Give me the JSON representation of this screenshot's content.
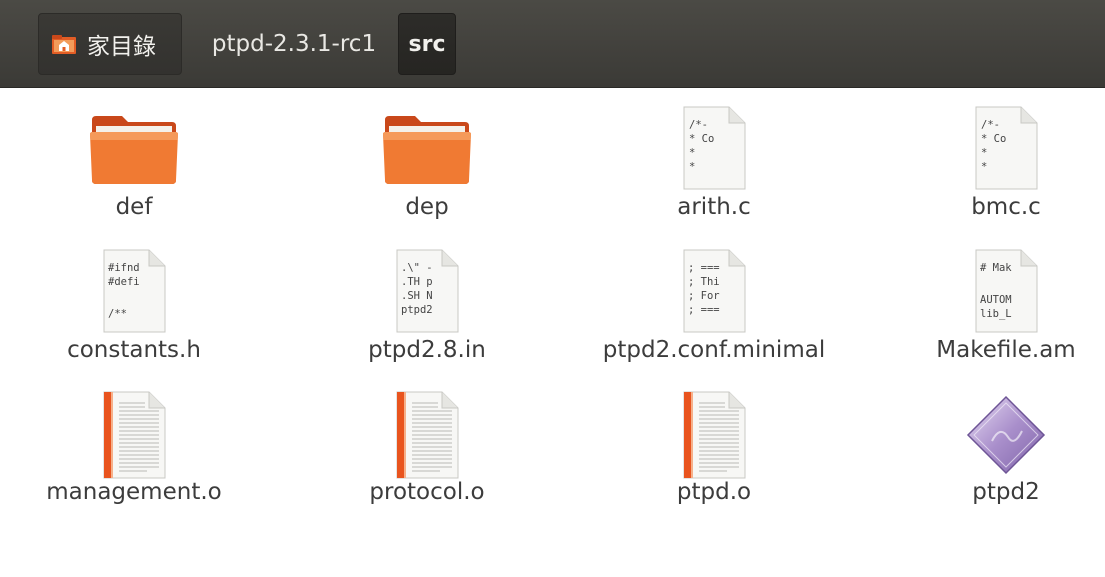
{
  "breadcrumb": {
    "home_label": "家目錄",
    "parent_label": "ptpd-2.3.1-rc1",
    "current_label": "src"
  },
  "files": [
    {
      "name": "def",
      "icon": "folder-icon",
      "preview": []
    },
    {
      "name": "dep",
      "icon": "folder-icon",
      "preview": []
    },
    {
      "name": "arith.c",
      "icon": "text-file-icon",
      "preview": [
        "/*-",
        " * Co",
        " *",
        " *"
      ]
    },
    {
      "name": "bmc.c",
      "icon": "text-file-icon",
      "preview": [
        "/*-",
        " * Co",
        " *",
        " *"
      ]
    },
    {
      "name": "constants.h",
      "icon": "text-file-icon",
      "preview": [
        "#ifnd",
        "#defi",
        "",
        "/**"
      ]
    },
    {
      "name": "ptpd2.8.in",
      "icon": "text-file-icon",
      "preview": [
        ".\\\" -",
        ".TH p",
        ".SH N",
        "ptpd2"
      ]
    },
    {
      "name": "ptpd2.conf.minimal",
      "icon": "text-file-icon",
      "preview": [
        "; ===",
        "; Thi",
        "; For",
        "; ==="
      ]
    },
    {
      "name": "Makefile.am",
      "icon": "text-file-icon",
      "preview": [
        "# Mak",
        "",
        "AUTOM",
        "lib_L"
      ]
    },
    {
      "name": "management.o",
      "icon": "object-file-icon",
      "preview": []
    },
    {
      "name": "protocol.o",
      "icon": "object-file-icon",
      "preview": []
    },
    {
      "name": "ptpd.o",
      "icon": "object-file-icon",
      "preview": []
    },
    {
      "name": "ptpd2",
      "icon": "executable-icon",
      "preview": []
    }
  ]
}
